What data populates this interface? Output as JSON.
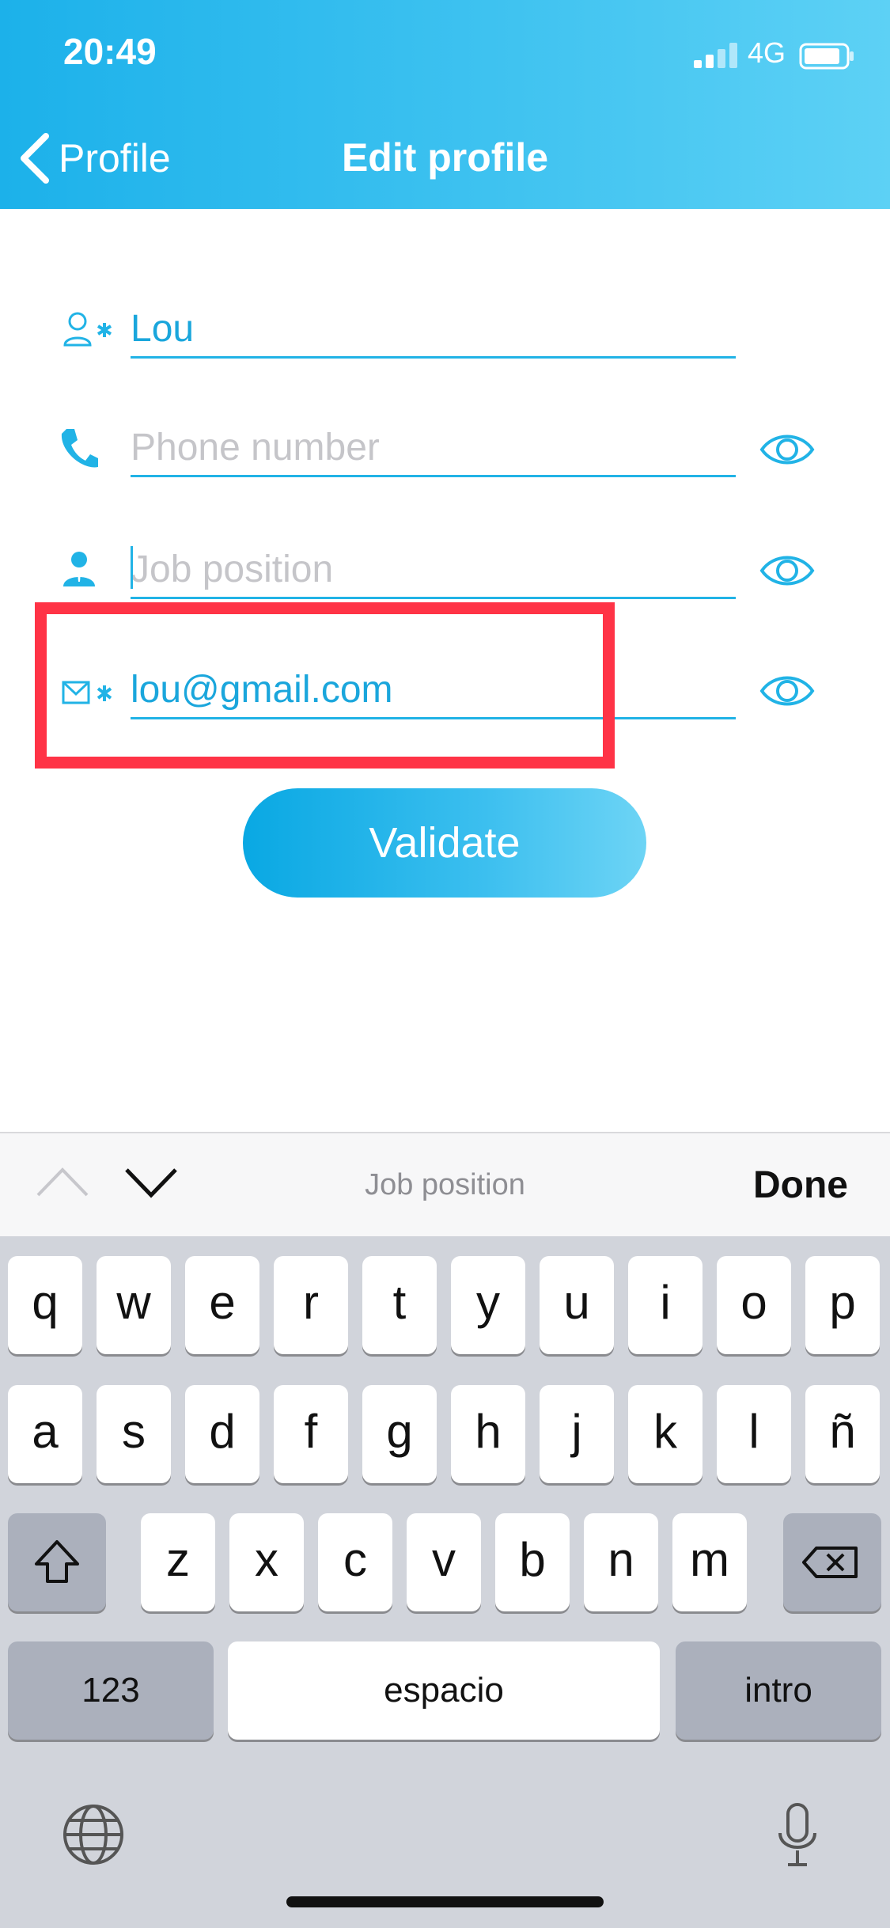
{
  "status_bar": {
    "time": "20:49",
    "network": "4G"
  },
  "nav": {
    "back_label": "Profile",
    "title": "Edit profile"
  },
  "form": {
    "name": {
      "value": "Lou",
      "required_mark": "*"
    },
    "phone": {
      "placeholder": "Phone number"
    },
    "job": {
      "placeholder": "Job position"
    },
    "email": {
      "value": "lou@gmail.com",
      "required_mark": "*"
    },
    "validate_label": "Validate"
  },
  "accessory": {
    "field_label": "Job position",
    "done_label": "Done"
  },
  "keyboard": {
    "row1": [
      "q",
      "w",
      "e",
      "r",
      "t",
      "y",
      "u",
      "i",
      "o",
      "p"
    ],
    "row2": [
      "a",
      "s",
      "d",
      "f",
      "g",
      "h",
      "j",
      "k",
      "l",
      "ñ"
    ],
    "row3": [
      "z",
      "x",
      "c",
      "v",
      "b",
      "n",
      "m"
    ],
    "numbers_label": "123",
    "space_label": "espacio",
    "return_label": "intro"
  },
  "colors": {
    "accent": "#21b3e6",
    "highlight": "#ff3346",
    "header": "#3ec2f0"
  }
}
